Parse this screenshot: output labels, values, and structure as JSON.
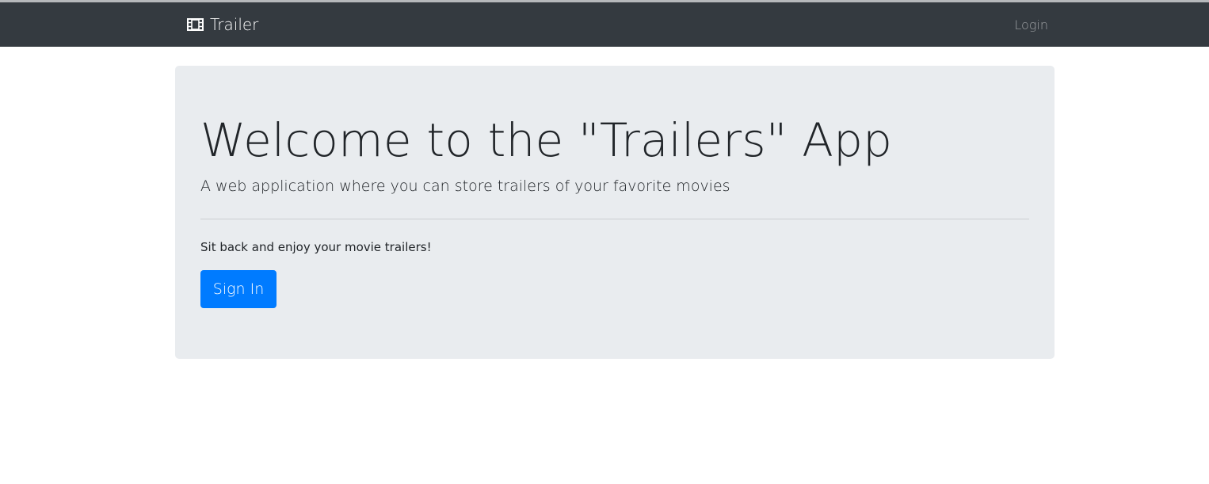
{
  "navbar": {
    "brand_icon": "film-icon",
    "brand_label": "Trailer",
    "login_label": "Login"
  },
  "jumbotron": {
    "title": "Welcome to the \"Trailers\" App",
    "lead": "A web application where you can store trailers of your favorite movies",
    "text": "Sit back and enjoy your movie trailers!",
    "signin_label": "Sign In"
  },
  "colors": {
    "navbar_bg": "#343a40",
    "jumbotron_bg": "#e9ecef",
    "primary_button": "#007bff"
  }
}
